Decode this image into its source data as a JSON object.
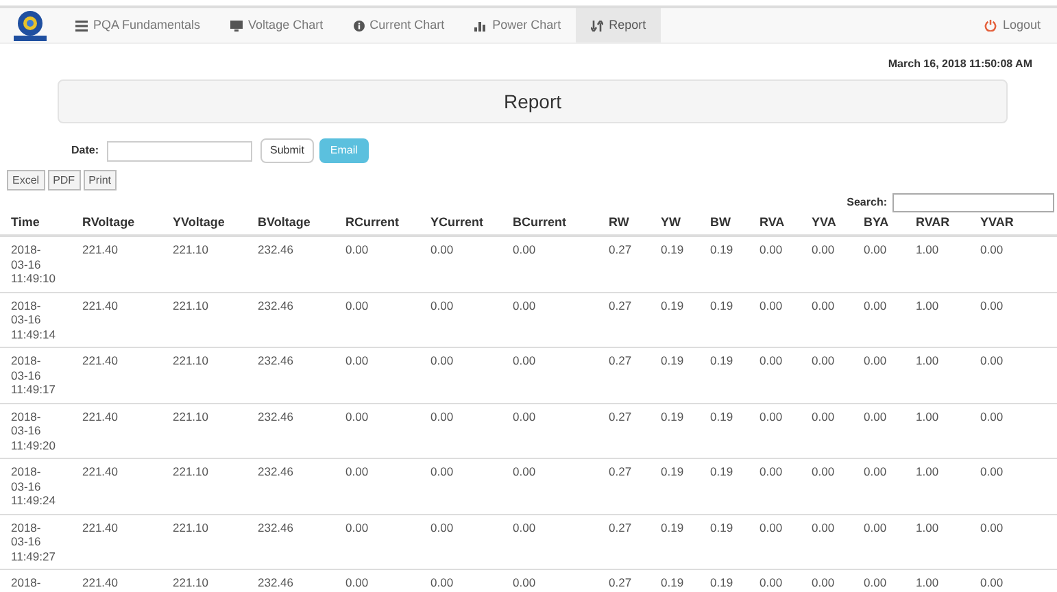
{
  "navbar": {
    "items": [
      {
        "label": "PQA Fundamentals",
        "selected": false
      },
      {
        "label": "Voltage Chart",
        "selected": false
      },
      {
        "label": "Current Chart",
        "selected": false
      },
      {
        "label": "Power Chart",
        "selected": false
      },
      {
        "label": "Report",
        "selected": true
      }
    ],
    "logout": "Logout"
  },
  "datetime": "March 16, 2018 11:50:08 AM",
  "panel_title": "Report",
  "date_form": {
    "label": "Date:",
    "submit": "Submit",
    "email": "Email"
  },
  "export_buttons": [
    "Excel",
    "PDF",
    "Print"
  ],
  "search_label": "Search:",
  "table": {
    "columns": [
      "Time",
      "RVoltage",
      "YVoltage",
      "BVoltage",
      "RCurrent",
      "YCurrent",
      "BCurrent",
      "RW",
      "YW",
      "BW",
      "RVA",
      "YVA",
      "BYA",
      "RVAR",
      "YVAR"
    ],
    "rows": [
      [
        "2018-\n03-16\n11:49:10",
        "221.40",
        "221.10",
        "232.46",
        "0.00",
        "0.00",
        "0.00",
        "0.27",
        "0.19",
        "0.19",
        "0.00",
        "0.00",
        "0.00",
        "1.00",
        "0.00"
      ],
      [
        "2018-\n03-16\n11:49:14",
        "221.40",
        "221.10",
        "232.46",
        "0.00",
        "0.00",
        "0.00",
        "0.27",
        "0.19",
        "0.19",
        "0.00",
        "0.00",
        "0.00",
        "1.00",
        "0.00"
      ],
      [
        "2018-\n03-16\n11:49:17",
        "221.40",
        "221.10",
        "232.46",
        "0.00",
        "0.00",
        "0.00",
        "0.27",
        "0.19",
        "0.19",
        "0.00",
        "0.00",
        "0.00",
        "1.00",
        "0.00"
      ],
      [
        "2018-\n03-16\n11:49:20",
        "221.40",
        "221.10",
        "232.46",
        "0.00",
        "0.00",
        "0.00",
        "0.27",
        "0.19",
        "0.19",
        "0.00",
        "0.00",
        "0.00",
        "1.00",
        "0.00"
      ],
      [
        "2018-\n03-16\n11:49:24",
        "221.40",
        "221.10",
        "232.46",
        "0.00",
        "0.00",
        "0.00",
        "0.27",
        "0.19",
        "0.19",
        "0.00",
        "0.00",
        "0.00",
        "1.00",
        "0.00"
      ],
      [
        "2018-\n03-16\n11:49:27",
        "221.40",
        "221.10",
        "232.46",
        "0.00",
        "0.00",
        "0.00",
        "0.27",
        "0.19",
        "0.19",
        "0.00",
        "0.00",
        "0.00",
        "1.00",
        "0.00"
      ],
      [
        "2018-",
        "221.40",
        "221.10",
        "232.46",
        "0.00",
        "0.00",
        "0.00",
        "0.27",
        "0.19",
        "0.19",
        "0.00",
        "0.00",
        "0.00",
        "1.00",
        "0.00"
      ]
    ]
  }
}
